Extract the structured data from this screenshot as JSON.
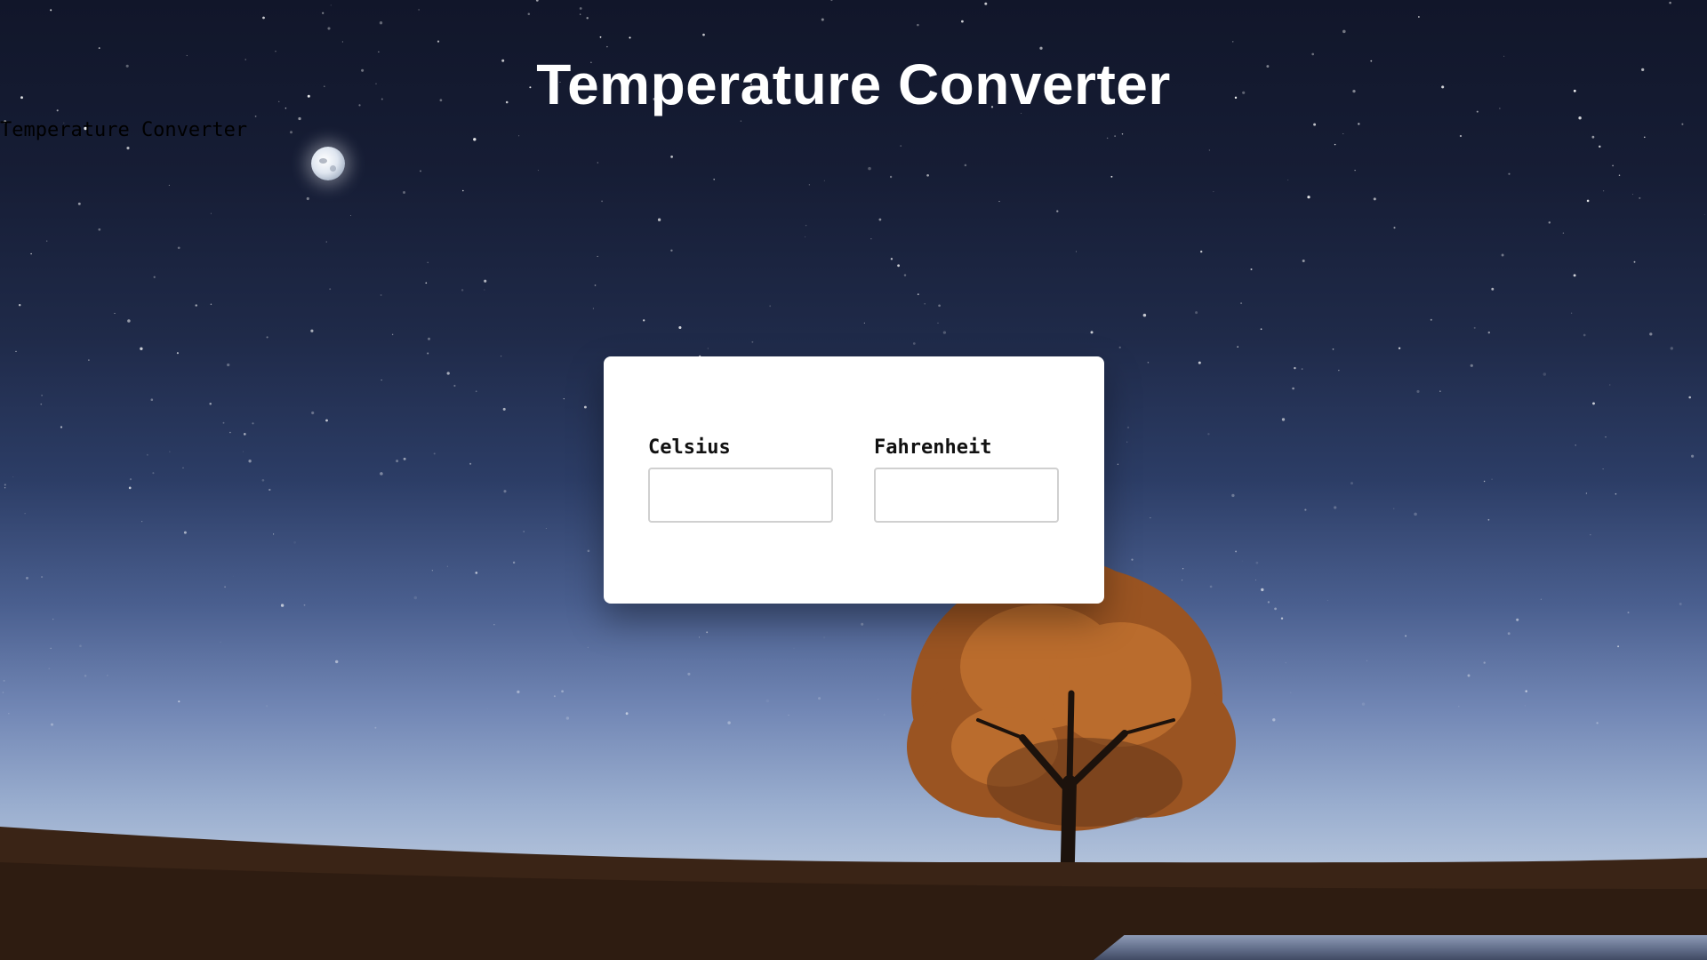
{
  "page": {
    "heading": "Temperature Converter",
    "document_title": "Temperature Converter"
  },
  "converter": {
    "celsius": {
      "label": "Celsius",
      "value": "",
      "placeholder": ""
    },
    "fahrenheit": {
      "label": "Fahrenheit",
      "value": "",
      "placeholder": ""
    }
  },
  "colors": {
    "sky_top": "#11162a",
    "sky_horizon": "#c8d3e2",
    "card_background": "#ffffff",
    "heading_color": "#ffffff",
    "tree_foliage": "#b5652a",
    "ground": "#3a2416"
  }
}
